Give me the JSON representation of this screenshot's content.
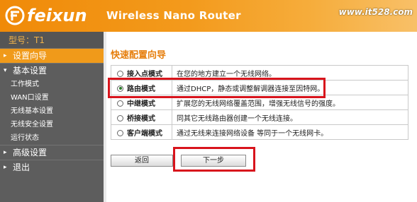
{
  "header": {
    "brand": "feixun",
    "product": "Wireless Nano Router",
    "watermark": "www.it528.com"
  },
  "sidebar": {
    "model": "型号：T1",
    "items": [
      {
        "label": "设置向导",
        "arrow": "▸",
        "active": true
      },
      {
        "label": "基本设置",
        "arrow": "▾",
        "active": false
      },
      {
        "label": "高级设置",
        "arrow": "▸",
        "active": false
      },
      {
        "label": "退出",
        "arrow": "▸",
        "active": false
      }
    ],
    "subitems": [
      "工作模式",
      "WAN口设置",
      "无线基本设置",
      "无线安全设置",
      "运行状态"
    ]
  },
  "main": {
    "title": "快速配置向导",
    "modes": [
      {
        "name": "接入点模式",
        "description": "在您的地方建立一个无线网络。",
        "selected": false
      },
      {
        "name": "路由模式",
        "description": "通过DHCP，静态或调整解调器连接至因特网。",
        "selected": true
      },
      {
        "name": "中继模式",
        "description": "扩展您的无线网络覆盖范围，增强无线信号的强度。",
        "selected": false
      },
      {
        "name": "桥接模式",
        "description": "同其它无线路由器创建一个无线连接。",
        "selected": false
      },
      {
        "name": "客户端模式",
        "description": "通过无线来连接网络设备 等同于一个无线网卡。",
        "selected": false
      }
    ],
    "back_label": "返回",
    "next_label": "下一步"
  },
  "colors": {
    "brand_orange": "#f08a08",
    "sidebar_bg": "#5d5d5d",
    "highlight_red": "#d8141c",
    "title_orange": "#e67e0c"
  }
}
